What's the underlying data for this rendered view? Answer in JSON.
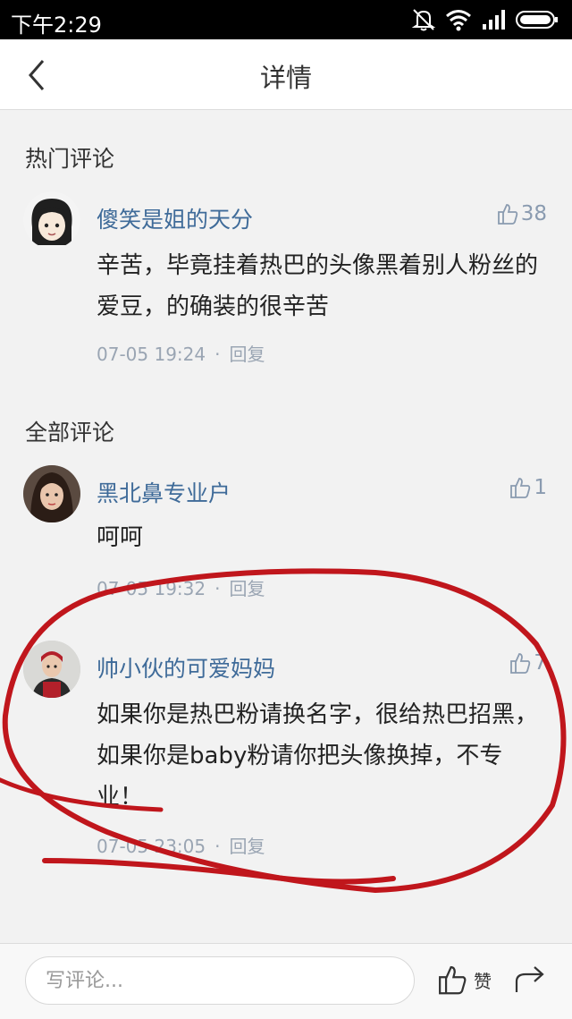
{
  "status_bar": {
    "time": "下午2:29"
  },
  "navbar": {
    "title": "详情"
  },
  "hot_section": {
    "title": "热门评论"
  },
  "all_section": {
    "title": "全部评论"
  },
  "hot_comments": [
    {
      "username": "傻笑是姐的天分",
      "likes": "38",
      "text": "辛苦，毕竟挂着热巴的头像黑着别人粉丝的爱豆，的确装的很辛苦",
      "time": "07-05 19:24",
      "reply": "回复"
    }
  ],
  "all_comments": [
    {
      "username": "黑北鼻专业户",
      "likes": "1",
      "text": "呵呵",
      "time": "07-05 19:32",
      "reply": "回复"
    },
    {
      "username": "帅小伙的可爱妈妈",
      "likes": "7",
      "text": "如果你是热巴粉请换名字，很给热巴招黑，如果你是baby粉请你把头像换掉，不专业！",
      "time": "07-05 23:05",
      "reply": "回复"
    }
  ],
  "meta_separator": "·",
  "bottom_bar": {
    "placeholder": "写评论...",
    "like_label": "赞"
  },
  "colors": {
    "username": "#3f6b99",
    "meta": "#9aa5b3",
    "annotation": "#c0161c"
  },
  "icons": [
    "back-icon",
    "mute-icon",
    "wifi-icon",
    "signal-icon",
    "battery-icon",
    "thumbs-up-icon",
    "share-icon"
  ]
}
